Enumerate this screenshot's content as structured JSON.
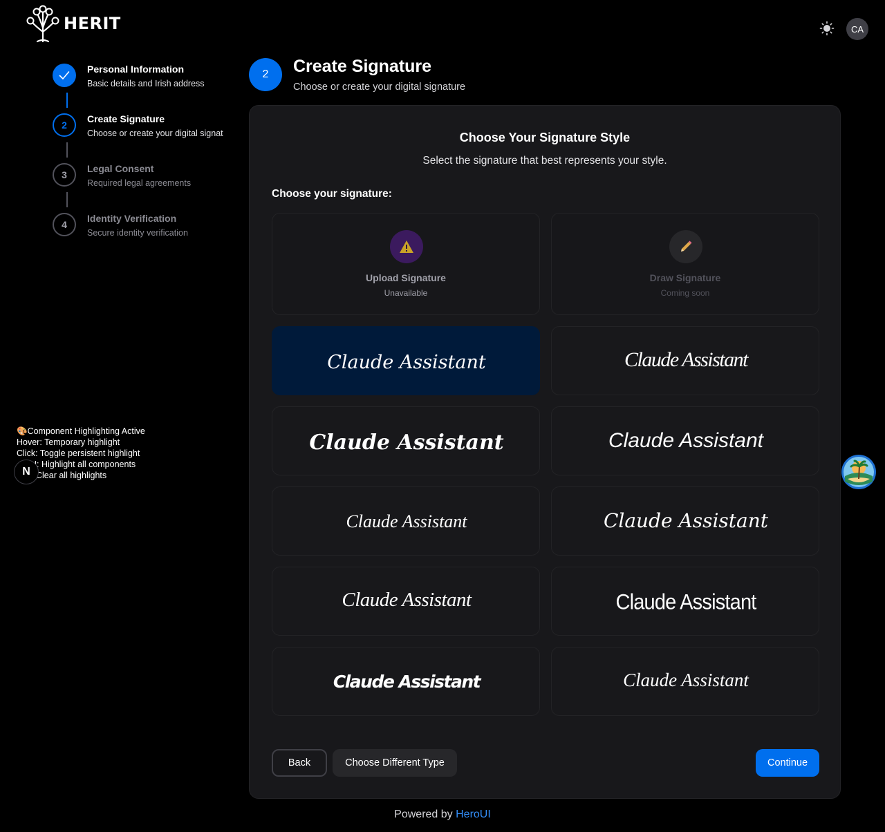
{
  "header": {
    "logo_text": "HERIT",
    "avatar_initials": "CA"
  },
  "stepper": [
    {
      "number": "✓",
      "title": "Personal Information",
      "desc": "Basic details and Irish address",
      "state": "done"
    },
    {
      "number": "2",
      "title": "Create Signature",
      "desc": "Choose or create your digital signat",
      "state": "active"
    },
    {
      "number": "3",
      "title": "Legal Consent",
      "desc": "Required legal agreements",
      "state": "todo"
    },
    {
      "number": "4",
      "title": "Identity Verification",
      "desc": "Secure identity verification",
      "state": "todo"
    }
  ],
  "highlight_info": {
    "line1": "🎨Component Highlighting Active",
    "line2": "Hover: Temporary highlight",
    "line3": "Click: Toggle persistent highlight",
    "line4": "H: Highlight all components",
    "line5": "Clear all highlights"
  },
  "n_badge": "N",
  "page": {
    "step_number": "2",
    "title": "Create Signature",
    "subtitle": "Choose or create your digital signature"
  },
  "card": {
    "heading": "Choose Your Signature Style",
    "subheading": "Select the signature that best represents your style.",
    "choose_label": "Choose your signature:",
    "upload": {
      "title": "Upload Signature",
      "status": "Unavailable",
      "icon": "warning-icon"
    },
    "draw": {
      "title": "Draw Signature",
      "status": "Coming soon",
      "icon": "pencil-icon"
    },
    "signature_text": "Claude Assistant",
    "signature_options_count": 10,
    "selected_index": 0
  },
  "buttons": {
    "back": "Back",
    "choose_different": "Choose Different Type",
    "continue": "Continue"
  },
  "footer": {
    "powered_prefix": "Powered by",
    "powered_link": "HeroUI"
  },
  "colors": {
    "accent": "#006fee",
    "selected_bg": "#001a3a",
    "card_bg": "#18181b"
  }
}
